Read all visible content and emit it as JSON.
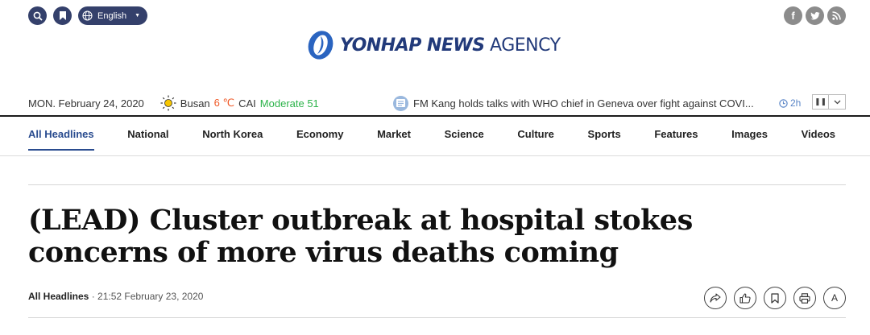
{
  "header": {
    "language_label": "English",
    "logo_bold": "YONHAP NEWS",
    "logo_light": "AGENCY"
  },
  "info_bar": {
    "date": "MON. February 24, 2020",
    "weather_city": "Busan",
    "weather_temp": "6 ℃",
    "cai_label": "CAI",
    "cai_value": "Moderate 51",
    "ticker_text": "FM Kang holds talks with WHO chief in Geneva over fight against COVI...",
    "time_ago": "2h"
  },
  "nav": {
    "items": [
      {
        "label": "All Headlines"
      },
      {
        "label": "National"
      },
      {
        "label": "North Korea"
      },
      {
        "label": "Economy"
      },
      {
        "label": "Market"
      },
      {
        "label": "Science"
      },
      {
        "label": "Culture"
      },
      {
        "label": "Sports"
      },
      {
        "label": "Features"
      },
      {
        "label": "Images"
      },
      {
        "label": "Videos"
      }
    ]
  },
  "article": {
    "headline": "(LEAD) Cluster outbreak at hospital stokes concerns of more virus deaths coming",
    "category": "All Headlines",
    "separator": " · ",
    "timestamp": "21:52 February 23, 2020",
    "font_size_label": "A"
  },
  "colors": {
    "brand": "#223a7a",
    "button_dark": "#34406b",
    "temp": "#f05a28",
    "cai": "#2cb34a",
    "time_ago": "#5b86c7"
  }
}
